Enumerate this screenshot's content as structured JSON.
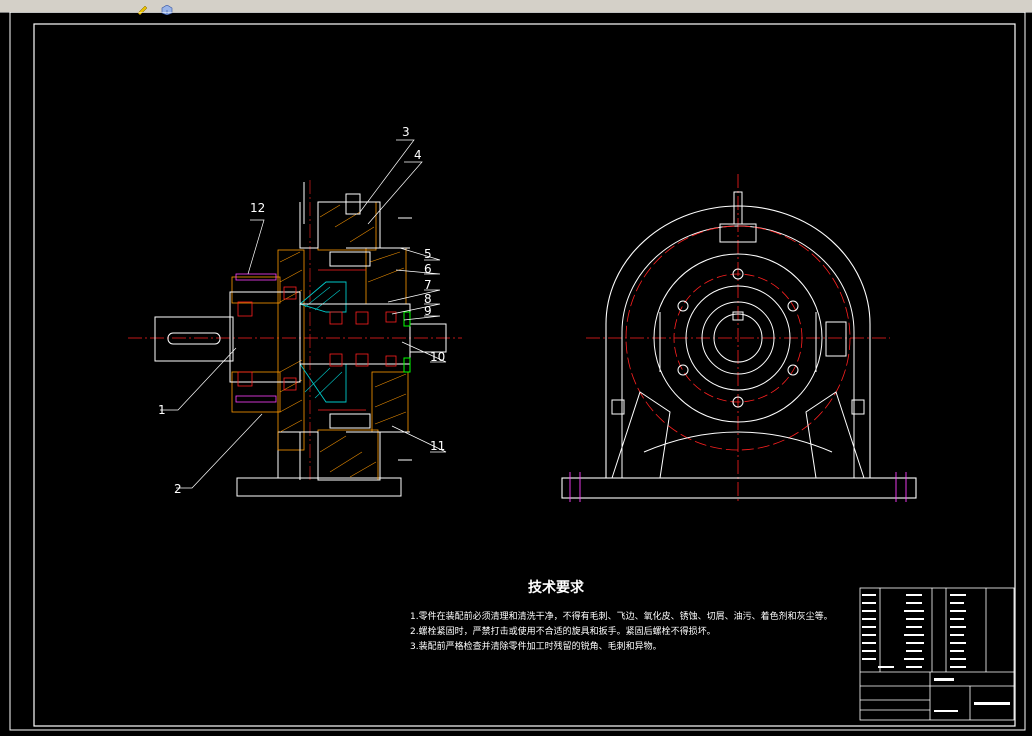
{
  "toolbar": {
    "icons": [
      "tool-pencil-icon",
      "tool-cube-icon"
    ]
  },
  "drawing": {
    "part_numbers": [
      "1",
      "2",
      "3",
      "4",
      "5",
      "6",
      "7",
      "8",
      "9",
      "10",
      "11",
      "12"
    ],
    "tech_requirements_title": "技术要求",
    "tech_requirements": [
      "1.零件在装配前必须清理和清洗干净，不得有毛刺、飞边、氧化皮、锈蚀、切屑、油污、着色剂和灰尘等。",
      "2.螺栓紧固时，严禁打击或使用不合适的旋具和扳手。紧固后螺栓不得损坏。",
      "3.装配前严格检查并清除零件加工时残留的锐角、毛刺和异物。"
    ],
    "colors": {
      "background": "#000000",
      "outline": "#ffffff",
      "hatch_orange": "#ff9900",
      "hatch_cyan": "#00c8c8",
      "center_line": "#ff2020",
      "bolt_magenta": "#ff40ff",
      "green": "#00ff00"
    }
  }
}
